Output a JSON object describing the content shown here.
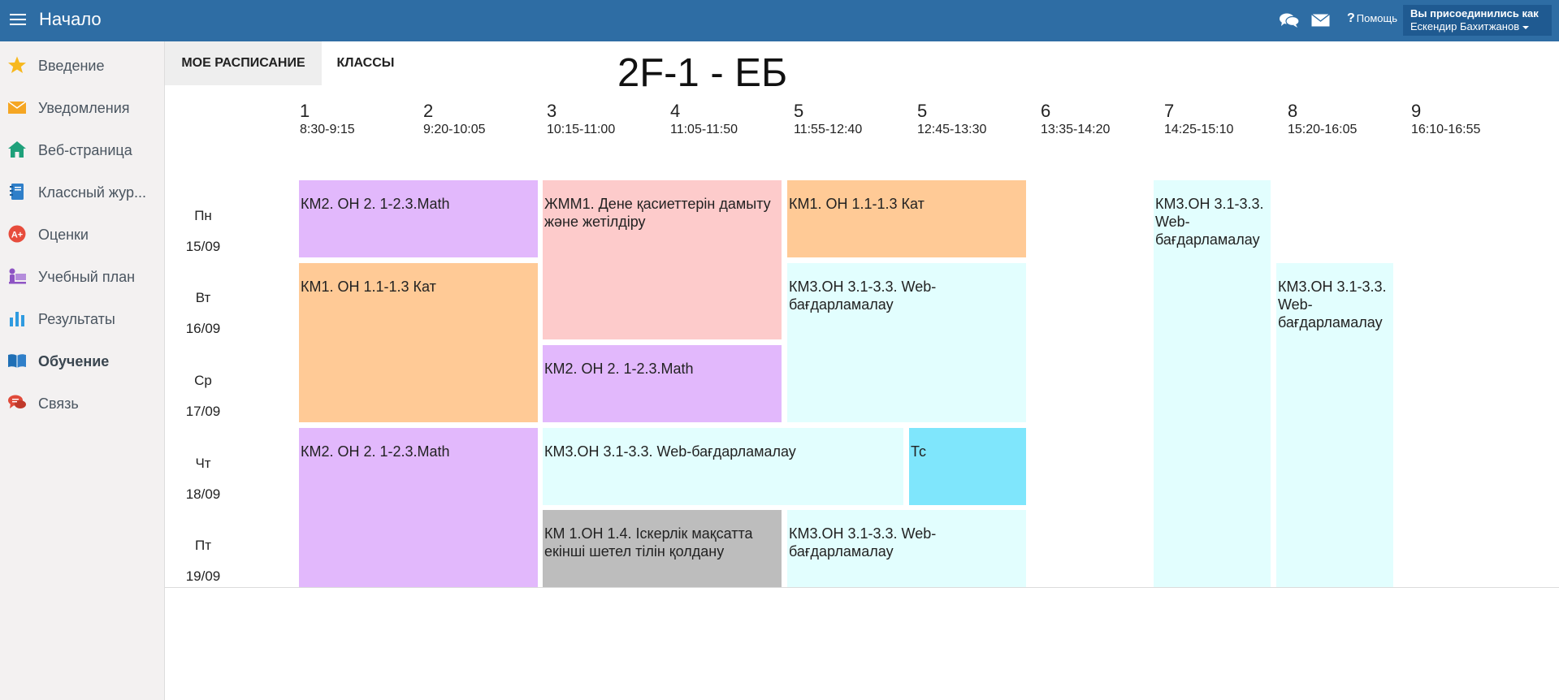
{
  "header": {
    "menu_icon": "hamburger-menu-icon",
    "title": "Начало",
    "icons": [
      "chat-bubbles-icon",
      "mail-envelope-icon"
    ],
    "help_label": "Помощь",
    "user": {
      "line1": "Вы присоединились как",
      "line2": "Ескендир Бахитжанов"
    }
  },
  "sidebar": {
    "items": [
      {
        "label": "Введение",
        "icon": "star-icon"
      },
      {
        "label": "Уведомления",
        "icon": "envelope-icon"
      },
      {
        "label": "Веб-страница",
        "icon": "home-icon"
      },
      {
        "label": "Классный жур...",
        "icon": "journal-book-icon"
      },
      {
        "label": "Оценки",
        "icon": "grade-badge-icon"
      },
      {
        "label": "Учебный план",
        "icon": "teacher-board-icon"
      },
      {
        "label": "Результаты",
        "icon": "bar-chart-icon"
      },
      {
        "label": "Обучение",
        "icon": "open-book-icon",
        "active": true
      },
      {
        "label": "Связь",
        "icon": "speech-bubbles-icon"
      }
    ]
  },
  "tabs": {
    "my_schedule": "МОЕ РАСПИСАНИЕ",
    "classes": "КЛАССЫ"
  },
  "schedule": {
    "title": "2F-1 - ЕБ",
    "periods": [
      {
        "num": "1",
        "time": "8:30-9:15"
      },
      {
        "num": "2",
        "time": "9:20-10:05"
      },
      {
        "num": "3",
        "time": "10:15-11:00"
      },
      {
        "num": "4",
        "time": "11:05-11:50"
      },
      {
        "num": "5",
        "time": "11:55-12:40"
      },
      {
        "num": "5",
        "time": "12:45-13:30"
      },
      {
        "num": "6",
        "time": "13:35-14:20"
      },
      {
        "num": "7",
        "time": "14:25-15:10"
      },
      {
        "num": "8",
        "time": "15:20-16:05"
      },
      {
        "num": "9",
        "time": "16:10-16:55"
      }
    ],
    "days": [
      {
        "name": "Пн",
        "date": "15/09"
      },
      {
        "name": "Вт",
        "date": "16/09"
      },
      {
        "name": "Ср",
        "date": "17/09"
      },
      {
        "name": "Чт",
        "date": "18/09"
      },
      {
        "name": "Пт",
        "date": "19/09"
      }
    ],
    "lessons": [
      {
        "text": "КМ2. ОН 2. 1-2.3.Math",
        "color": "#e2b8fc"
      },
      {
        "text": "ЖММ1. Дене қасиеттерін дамыту және жетілдіру",
        "color": "#fdcbcb"
      },
      {
        "text": "КМ1. ОН 1.1-1.3 Кат",
        "color": "#ffca96"
      },
      {
        "text": "КМ3.ОН 3.1-3.3. Web-бағдарламалау",
        "color": "#e2fefe"
      },
      {
        "text": "КМ1. ОН 1.1-1.3 Кат",
        "color": "#ffca96"
      },
      {
        "text": "КМ3.ОН 3.1-3.3. Web-бағдарламалау",
        "color": "#e2fefe"
      },
      {
        "text": "КМ3.ОН 3.1-3.3. Web-бағдарламалау",
        "color": "#e2fefe"
      },
      {
        "text": "КМ2. ОН 2. 1-2.3.Math",
        "color": "#e2b8fc"
      },
      {
        "text": "КМ2. ОН 2. 1-2.3.Math",
        "color": "#e2b8fc"
      },
      {
        "text": "КМ3.ОН 3.1-3.3. Web-бағдарламалау",
        "color": "#e2fefe"
      },
      {
        "text": "Тс",
        "color": "#7fe6fc"
      },
      {
        "text": "КМ 1.ОН 1.4. Іскерлік мақсатта екінші шетел тілін қолдану",
        "color": "#bdbdbd"
      },
      {
        "text": "КМ3.ОН 3.1-3.3. Web-бағдарламалау",
        "color": "#e2fefe"
      }
    ]
  }
}
